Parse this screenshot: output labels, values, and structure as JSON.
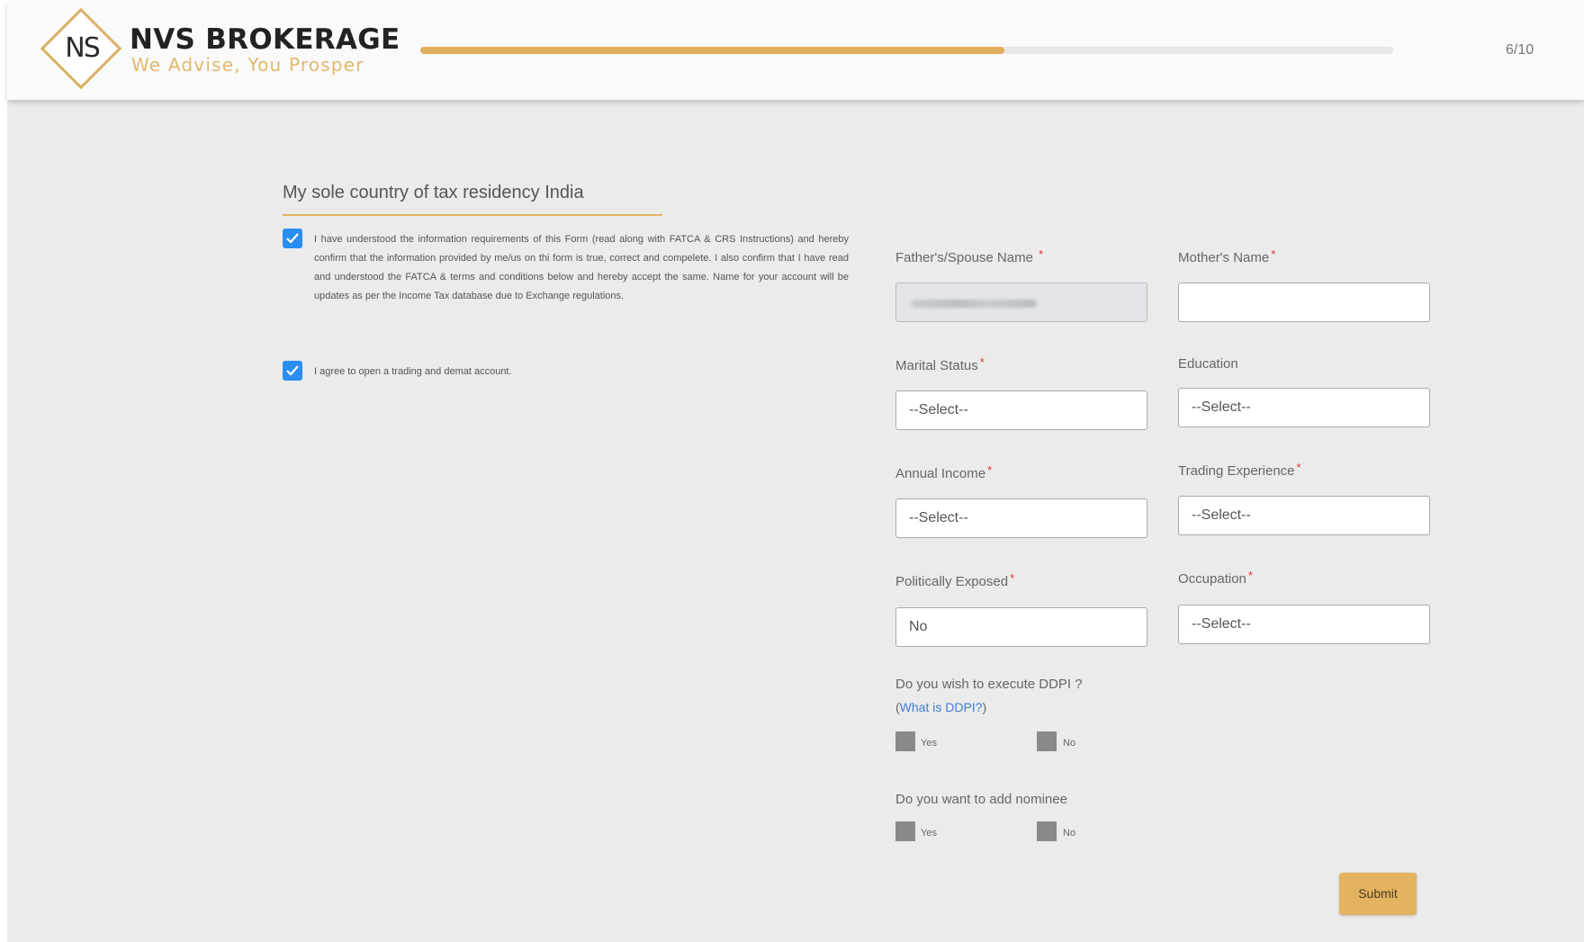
{
  "header": {
    "brand_letters": "NS",
    "brand_name": "NVS BROKERAGE",
    "brand_tagline": "We Advise, You Prosper",
    "progress_fraction": 0.6,
    "step_counter": "6/10"
  },
  "left": {
    "section_title": "My sole country of tax residency India",
    "consent_fatca": "I have understood the information requirements of this Form (read along with FATCA & CRS Instructions) and hereby confirm that the information provided by me/us on thi form is true, correct and compelete. I also confirm that I have read and understood the FATCA & terms and conditions below and hereby accept the same. Name for your account will be updates as per the Income Tax database due to Exchange regulations.",
    "consent_fatca_checked": true,
    "consent_account": "I agree to open a trading and demat account.",
    "consent_account_checked": true
  },
  "form": {
    "father_spouse_label": "Father's/Spouse Name",
    "mother_label": "Mother's Name",
    "mother_value": "",
    "marital_label": "Marital Status",
    "marital_value": "--Select--",
    "education_label": "Education",
    "education_value": "--Select--",
    "income_label": "Annual Income",
    "income_value": "--Select--",
    "trading_label": "Trading Experience",
    "trading_value": "--Select--",
    "politically_label": "Politically Exposed",
    "politically_value": "No",
    "occupation_label": "Occupation",
    "occupation_value": "--Select--",
    "required_mark": "*",
    "ddpi_question": "Do you wish to execute DDPI ?",
    "ddpi_open_paren": "(",
    "ddpi_link": "What is DDPI?",
    "ddpi_close_paren": ")",
    "ddpi_yes": "Yes",
    "ddpi_no": "No",
    "nominee_question": "Do you want to add nominee",
    "nominee_yes": "Yes",
    "nominee_no": "No",
    "submit_label": "Submit"
  },
  "colors": {
    "accent_gold": "#e2b360",
    "checkbox_blue": "#2a8ef0",
    "required_red": "#e23030",
    "link_blue": "#3f7dd6"
  }
}
